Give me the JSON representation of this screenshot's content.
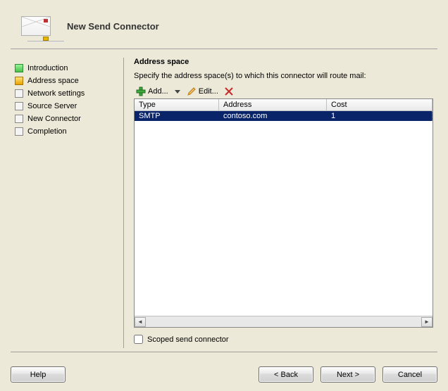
{
  "header": {
    "title": "New Send Connector"
  },
  "sidebar": {
    "steps": [
      {
        "label": "Introduction",
        "state": "done"
      },
      {
        "label": "Address space",
        "state": "current"
      },
      {
        "label": "Network settings",
        "state": "pending"
      },
      {
        "label": "Source Server",
        "state": "pending"
      },
      {
        "label": "New Connector",
        "state": "pending"
      },
      {
        "label": "Completion",
        "state": "pending"
      }
    ]
  },
  "main": {
    "title": "Address space",
    "description": "Specify the address space(s) to which this connector will route mail:",
    "toolbar": {
      "add_label": "Add...",
      "edit_label": "Edit..."
    },
    "columns": {
      "type": "Type",
      "address": "Address",
      "cost": "Cost"
    },
    "rows": [
      {
        "type": "SMTP",
        "address": "contoso.com",
        "cost": "1",
        "selected": true
      }
    ],
    "scoped_label": "Scoped send connector",
    "scoped_checked": false
  },
  "footer": {
    "help": "Help",
    "back": "< Back",
    "next": "Next >",
    "cancel": "Cancel"
  }
}
